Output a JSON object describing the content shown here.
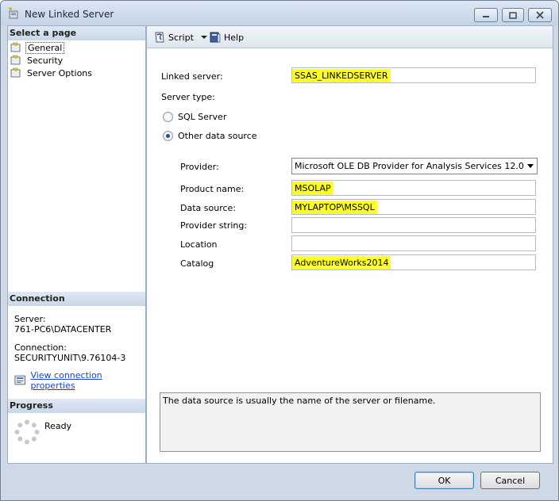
{
  "window": {
    "title": "New Linked Server"
  },
  "left_pane": {
    "select_page_header": "Select a page",
    "pages": [
      {
        "label": "General",
        "selected": true
      },
      {
        "label": "Security",
        "selected": false
      },
      {
        "label": "Server Options",
        "selected": false
      }
    ],
    "connection_header": "Connection",
    "server_label": "Server:",
    "server_value": "761-PC6\\DATACENTER",
    "connection_label": "Connection:",
    "connection_value": "SECURITYUNIT\\9.76104-3",
    "view_props_link": "View connection properties",
    "progress_header": "Progress",
    "progress_status": "Ready"
  },
  "toolbar": {
    "script_label": "Script",
    "help_label": "Help"
  },
  "form": {
    "linked_server_label": "Linked server:",
    "linked_server_value": "SSAS_LINKEDSERVER",
    "server_type_label": "Server type:",
    "sql_server_label": "SQL Server",
    "other_source_label": "Other data source",
    "selected_server_type": "other",
    "provider_label": "Provider:",
    "provider_value": "Microsoft OLE DB Provider for Analysis Services 12.0",
    "product_name_label": "Product name:",
    "product_name_value": "MSOLAP",
    "data_source_label": "Data source:",
    "data_source_value": "MYLAPTOP\\MSSQL",
    "provider_string_label": "Provider string:",
    "provider_string_value": "",
    "location_label": "Location",
    "location_value": "",
    "catalog_label": "Catalog",
    "catalog_value": "AdventureWorks2014"
  },
  "description": "The data source is usually the name of the server or filename.",
  "buttons": {
    "ok": "OK",
    "cancel": "Cancel"
  },
  "colors": {
    "highlight": "#ffff24",
    "link": "#1a44c8",
    "section_header": "#c9d7e8"
  }
}
